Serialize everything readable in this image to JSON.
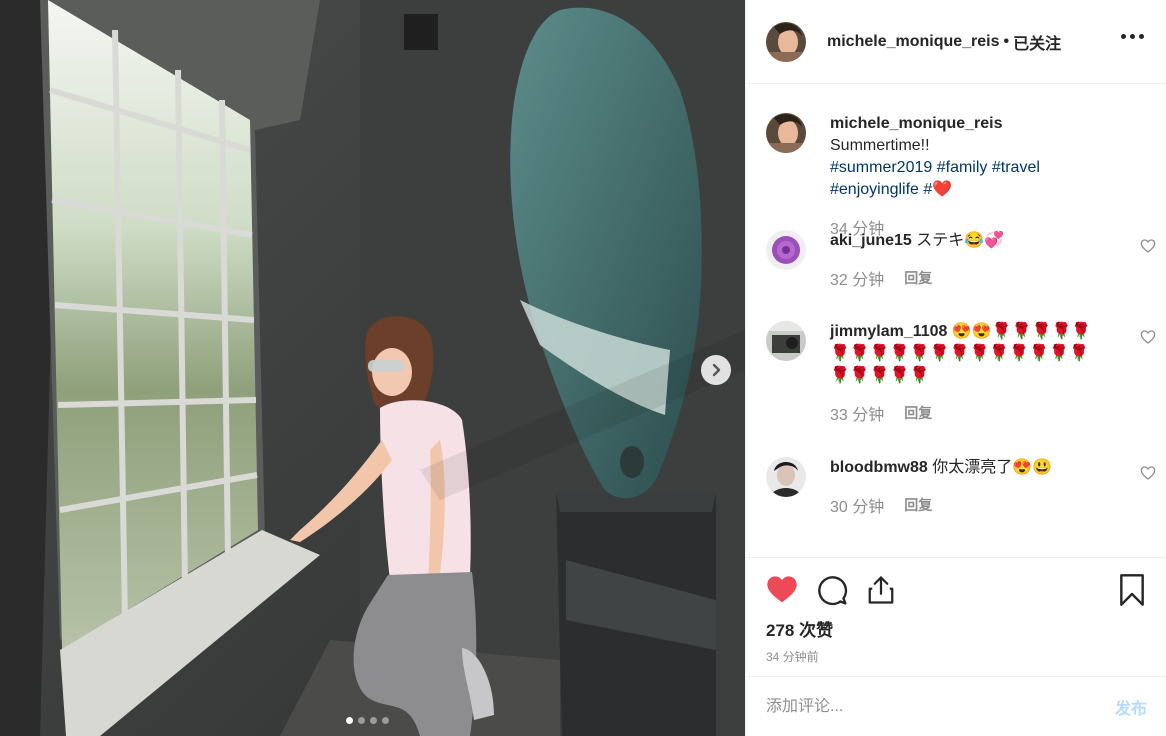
{
  "post": {
    "image_alt": "Woman in pink t-shirt beside large window and horse head sculpture",
    "carousel_dots": 4,
    "active_dot": 0
  },
  "header": {
    "username": "michele_monique_reis",
    "separator": "•",
    "follow_status": "已关注"
  },
  "caption": {
    "username": "michele_monique_reis",
    "text": "Summertime!!",
    "tags": [
      "#summer2019",
      "#family",
      "#travel",
      "#enjoyinglife",
      "#"
    ],
    "emoji": "❤️",
    "time": "34 分钟"
  },
  "comments": [
    {
      "username": "aki_june15",
      "text": "ステキ😂💞",
      "time": "32 分钟",
      "reply": "回复"
    },
    {
      "username": "jimmylam_1108",
      "text": "😍😍🌹🌹🌹🌹🌹🌹🌹🌹🌹🌹🌹🌹🌹🌹🌹🌹🌹🌹🌹🌹🌹🌹🌹",
      "time": "33 分钟",
      "reply": "回复"
    },
    {
      "username": "bloodbmw88",
      "text": "你太漂亮了😍😃",
      "time": "30 分钟",
      "reply": "回复"
    }
  ],
  "stats": {
    "likes": "278 次赞",
    "posted": "34 分钟前"
  },
  "add_comment": {
    "placeholder": "添加评论...",
    "post_label": "发布"
  },
  "colors": {
    "liked_heart": "#ed4956",
    "hashtag": "#00376b",
    "post_disabled": "#b3dbff"
  }
}
